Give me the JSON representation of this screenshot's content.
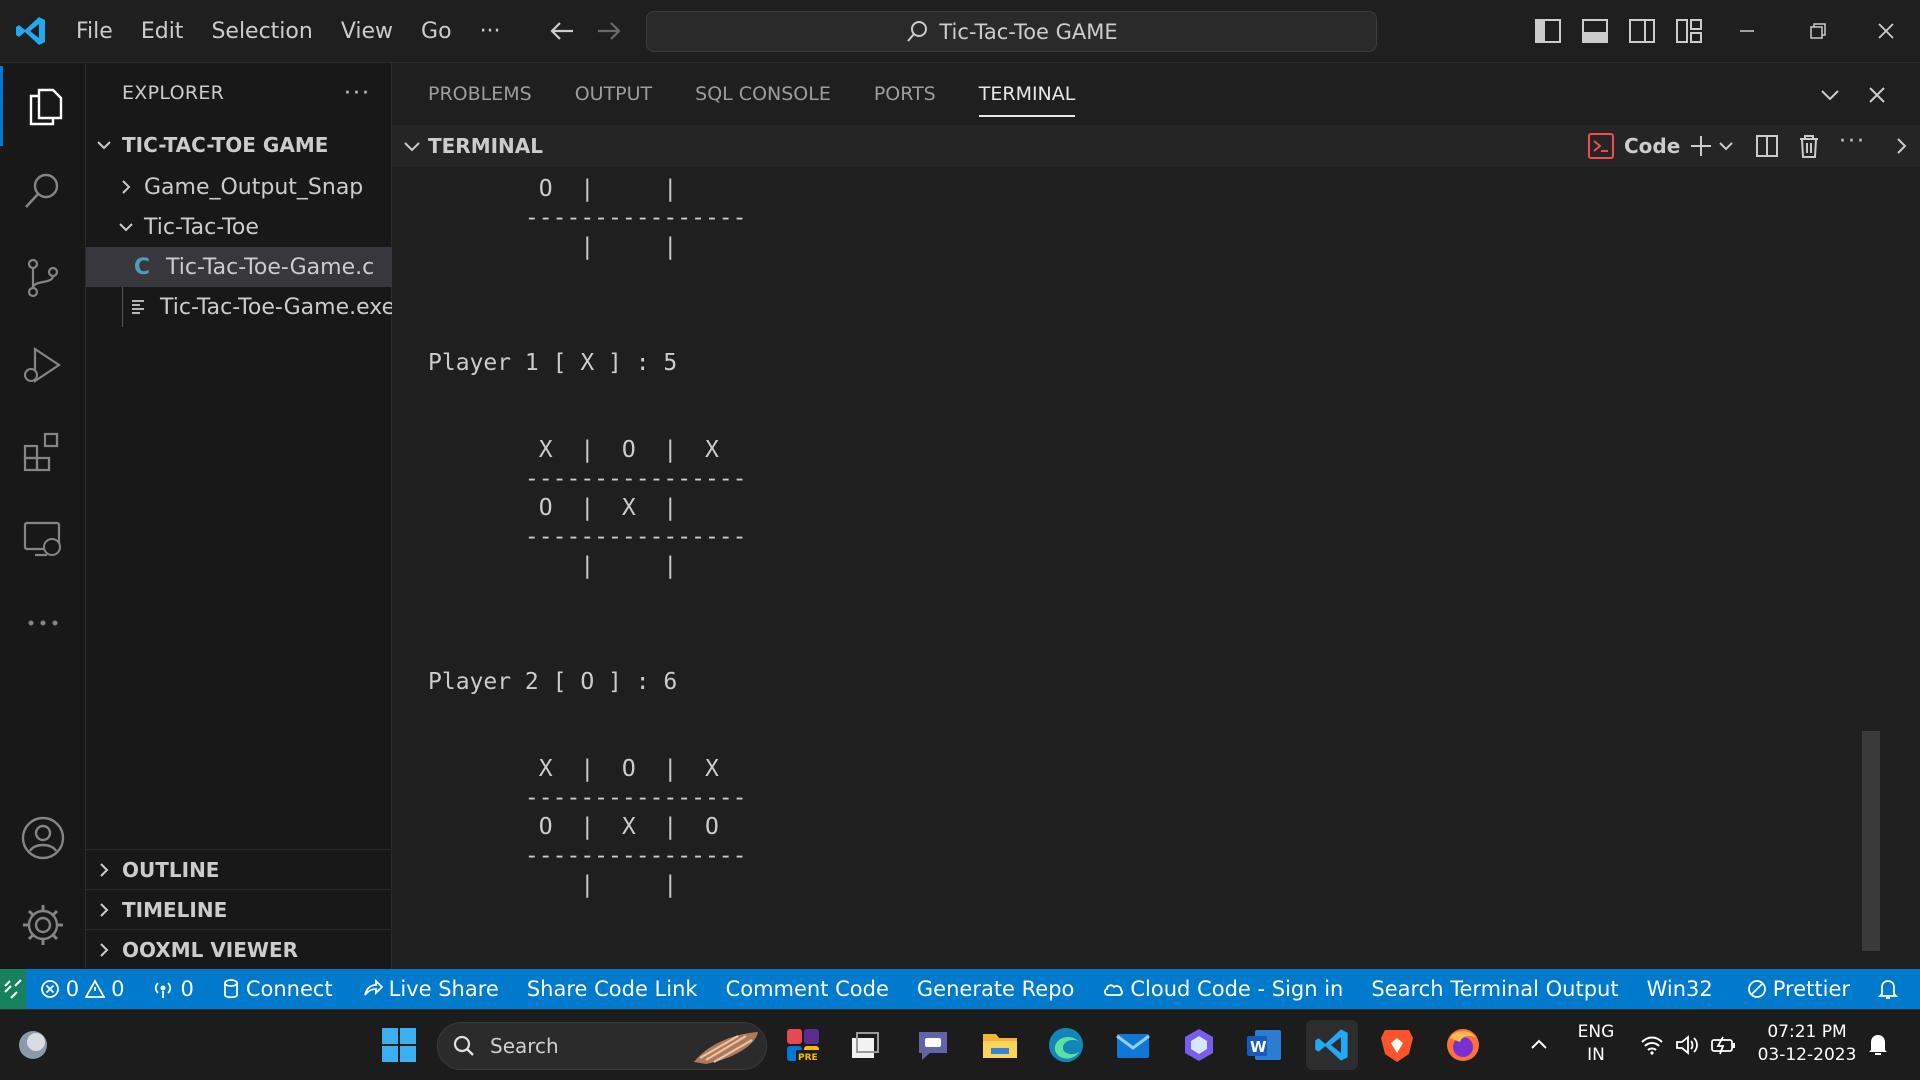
{
  "titlebar": {
    "menu": [
      "File",
      "Edit",
      "Selection",
      "View",
      "Go"
    ],
    "more": "···",
    "search_text": "Tic-Tac-Toe GAME"
  },
  "explorer": {
    "title": "EXPLORER",
    "more": "···",
    "root": "TIC-TAC-TOE GAME",
    "items": [
      {
        "label": "Game_Output_Snap",
        "icon": "chevron-right-icon"
      },
      {
        "label": "Tic-Tac-Toe",
        "icon": "chevron-down-icon"
      },
      {
        "label": "Tic-Tac-Toe-Game.c",
        "icon": "c-file-icon",
        "glyph": "C"
      },
      {
        "label": "Tic-Tac-Toe-Game.exe",
        "icon": "exe-file-icon"
      }
    ],
    "sections": [
      "OUTLINE",
      "TIMELINE",
      "OOXML VIEWER"
    ]
  },
  "panel": {
    "tabs": [
      "PROBLEMS",
      "OUTPUT",
      "SQL CONSOLE",
      "PORTS",
      "TERMINAL"
    ],
    "active_tab": "TERMINAL",
    "terminal_title": "TERMINAL",
    "shell_label": "Code",
    "more": "···"
  },
  "terminal": {
    "lines": [
      "        O  |     |",
      "       ----------------",
      "           |     |",
      "",
      "",
      "",
      "Player 1 [ X ] : 5",
      "",
      "",
      "        X  |  O  |  X",
      "       ----------------",
      "        O  |  X  |",
      "       ----------------",
      "           |     |",
      "",
      "",
      "",
      "Player 2 [ O ] : 6",
      "",
      "",
      "        X  |  O  |  X",
      "       ----------------",
      "        O  |  X  |  O",
      "       ----------------",
      "           |     |"
    ]
  },
  "statusbar": {
    "errors": "0",
    "warnings": "0",
    "ports": "0",
    "items": [
      "Connect",
      "Live Share",
      "Share Code Link",
      "Comment Code",
      "Generate Repo",
      "Cloud Code - Sign in",
      "Search Terminal Output"
    ],
    "platform": "Win32",
    "prettier": "Prettier"
  },
  "taskbar": {
    "search_placeholder": "Search",
    "lang_top": "ENG",
    "lang_bottom": "IN",
    "time": "07:21 PM",
    "date": "03-12-2023"
  },
  "colors": {
    "accent": "#007acc",
    "remote": "#16825d",
    "vscode_blue": "#23a8f2"
  }
}
